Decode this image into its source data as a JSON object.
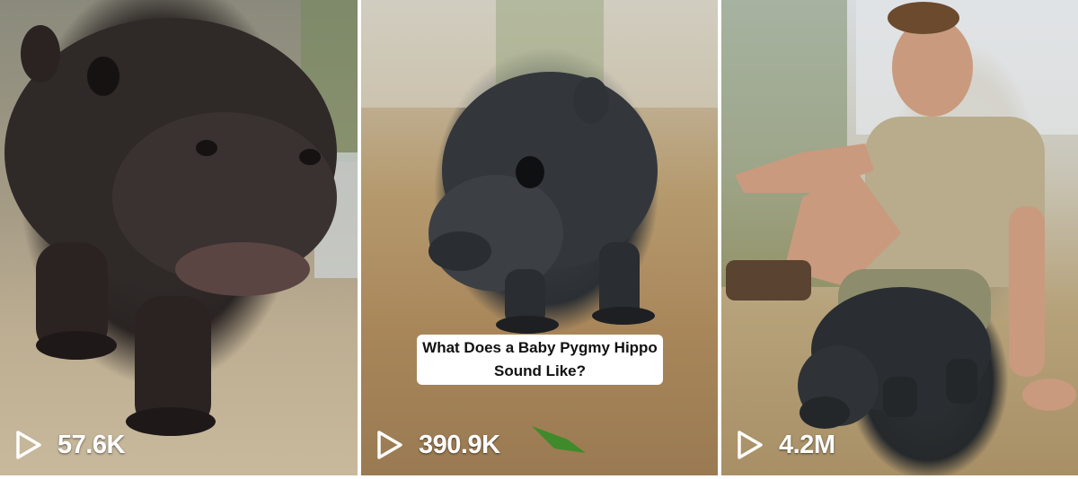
{
  "videos": [
    {
      "views": "57.6K",
      "caption": ""
    },
    {
      "views": "390.9K",
      "caption": "What Does a Baby Pygmy Hippo Sound Like?"
    },
    {
      "views": "4.2M",
      "caption": ""
    }
  ],
  "icons": {
    "play": "play-icon"
  }
}
